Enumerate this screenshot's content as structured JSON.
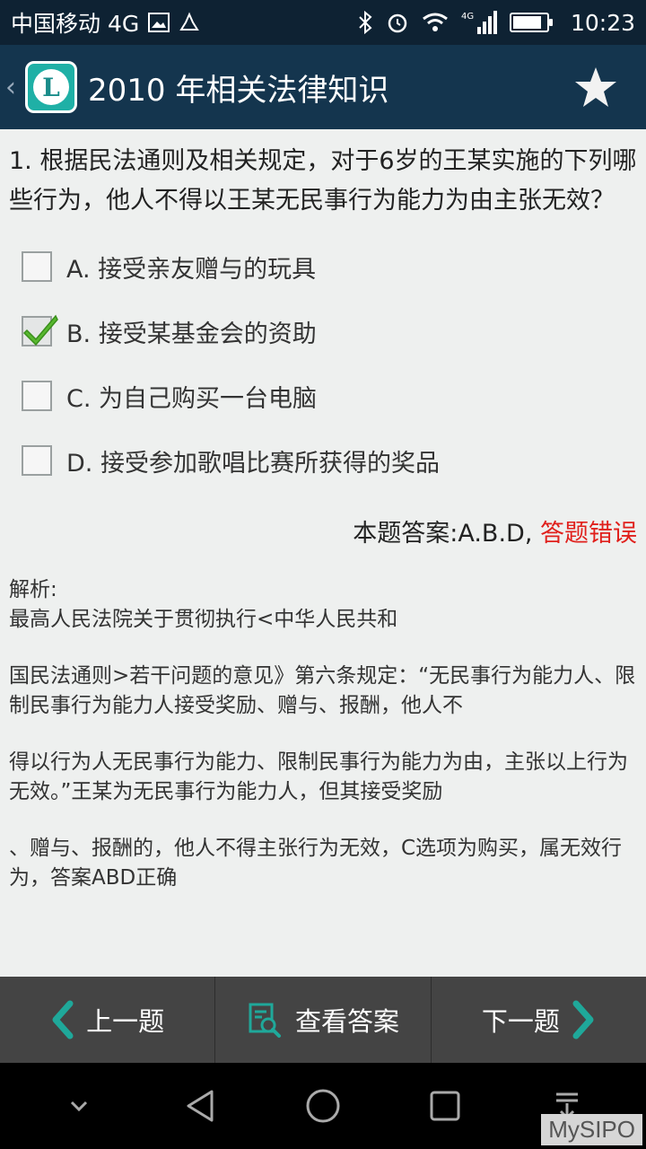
{
  "status_bar": {
    "carrier": "中国移动 4G",
    "network": "4G",
    "time": "10:23"
  },
  "app_bar": {
    "title": "2010 年相关法律知识",
    "logo_letter": "L"
  },
  "question": {
    "text": "1. 根据民法通则及相关规定，对于6岁的王某实施的下列哪些行为，他人不得以王某无民事行为能力为由主张无效？",
    "options": [
      {
        "label": "A. 接受亲友赠与的玩具",
        "checked": false
      },
      {
        "label": "B. 接受某基金会的资助",
        "checked": true
      },
      {
        "label": "C. 为自己购买一台电脑",
        "checked": false
      },
      {
        "label": "D. 接受参加歌唱比赛所获得的奖品",
        "checked": false
      }
    ]
  },
  "answer": {
    "prefix": "本题答案:A.B.D,",
    "result": "答题错误",
    "result_color": "#e0201c"
  },
  "analysis": {
    "heading": "解析:",
    "lines": [
      "最高人民法院关于贯彻执行<中华人民共和",
      "国民法通则>若干问题的意见》第六条规定：“无民事行为能力人、限制民事行为能力人接受奖励、赠与、报酬，他人不",
      "得以行为人无民事行为能力、限制民事行为能力为由，主张以上行为无效。”王某为无民事行为能力人，但其接受奖励",
      "、赠与、报酬的，他人不得主张行为无效，C选项为购买，属无效行为，答案ABD正确"
    ]
  },
  "actions": {
    "prev": "上一题",
    "view_answer": "查看答案",
    "next": "下一题"
  },
  "colors": {
    "accent": "#1fa89a",
    "appbar": "#14354e"
  },
  "watermark": "MySIPO"
}
